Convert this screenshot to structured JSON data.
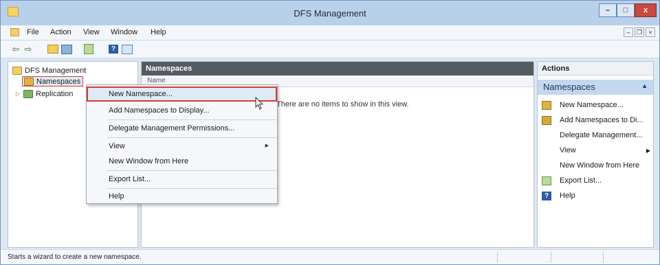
{
  "window": {
    "title": "DFS Management"
  },
  "title_buttons": {
    "minimize": "–",
    "maximize": "□",
    "close": "x"
  },
  "menubar": {
    "items": [
      "File",
      "Action",
      "View",
      "Window",
      "Help"
    ]
  },
  "tree": {
    "root": "DFS Management",
    "items": [
      {
        "label": "Namespaces",
        "selected": true
      },
      {
        "label": "Replication",
        "expandable": true
      }
    ]
  },
  "center": {
    "header": "Namespaces",
    "column_header": "Name",
    "empty_message": "There are no items to show in this view."
  },
  "context_menu": {
    "items": [
      {
        "label": "New Namespace...",
        "highlighted": true
      },
      {
        "label": "Add Namespaces to Display..."
      },
      {
        "label": "Delegate Management Permissions..."
      },
      {
        "label": "View",
        "submenu": true
      },
      {
        "label": "New Window from Here"
      },
      {
        "label": "Export List..."
      },
      {
        "label": "Help"
      }
    ]
  },
  "actions": {
    "header": "Actions",
    "section": "Namespaces",
    "items": [
      {
        "label": "New Namespace...",
        "icon": "namespace-icon"
      },
      {
        "label": "Add Namespaces to Di...",
        "icon": "add-namespace-icon"
      },
      {
        "label": "Delegate Management...",
        "icon": ""
      },
      {
        "label": "View",
        "icon": "",
        "submenu": true
      },
      {
        "label": "New Window from Here",
        "icon": ""
      },
      {
        "label": "Export List...",
        "icon": "export-icon"
      },
      {
        "label": "Help",
        "icon": "help-icon"
      }
    ]
  },
  "status": {
    "text": "Starts a wizard to create a new namespace."
  },
  "colors": {
    "highlight_border": "#d53b2f",
    "titlebar": "#b9d0ea",
    "section_header": "#545b63"
  }
}
